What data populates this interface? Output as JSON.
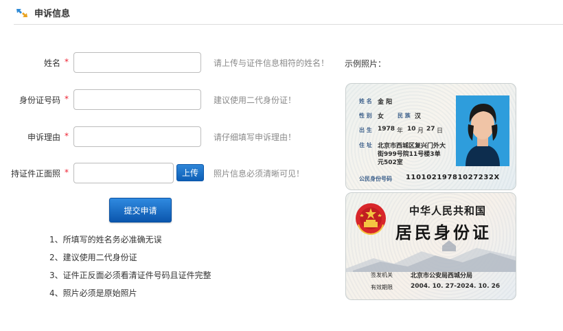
{
  "header": {
    "title": "申诉信息",
    "icon": "resize-arrows-icon"
  },
  "form": {
    "required_mark": "*",
    "name": {
      "label": "姓名",
      "value": "",
      "placeholder": "",
      "hint": "请上传与证件信息相符的姓名！"
    },
    "id_number": {
      "label": "身份证号码",
      "value": "",
      "placeholder": "",
      "hint": "建议使用二代身份证！"
    },
    "reason": {
      "label": "申诉理由",
      "value": "",
      "placeholder": "",
      "hint": "请仔细填写申诉理由！"
    },
    "photo": {
      "label": "持证件正面照",
      "value": "",
      "placeholder": "",
      "upload_label": "上传",
      "hint": "照片信息必须清晰可见！"
    },
    "submit_label": "提交申请"
  },
  "notes": [
    "1、所填写的姓名务必准确无误",
    "2、建议使用二代身份证",
    "3、证件正反面必须看清证件号码且证件完整",
    "4、照片必须是原始照片"
  ],
  "sample": {
    "label": "示例照片：",
    "front": {
      "name_key": "姓 名",
      "name_val": "金 阳",
      "sex_key": "性 别",
      "sex_val": "女",
      "nation_key": "民 族",
      "nation_val": "汉",
      "birth_key": "出 生",
      "birth_year": "1978",
      "year_unit": "年",
      "birth_month": "10",
      "month_unit": "月",
      "birth_day": "27",
      "day_unit": "日",
      "addr_key": "住 址",
      "addr_line1": "北京市西城区复兴门外大",
      "addr_line2": "街999号院11号楼3单",
      "addr_line3": "元502室",
      "idnum_key": "公民身份号码",
      "idnum_val": "11010219781027232X"
    },
    "back": {
      "country": "中华人民共和国",
      "title": "居民身份证",
      "authority_key": "签发机关",
      "authority_val": "北京市公安局西城分局",
      "validity_key": "有效期限",
      "validity_val": "2004. 10. 27-2024. 10. 26"
    }
  },
  "colors": {
    "accent_button": "#1567c2",
    "required": "#e22233",
    "hint_text": "#8a8a8a",
    "photo_bg": "#2e9ddc"
  }
}
